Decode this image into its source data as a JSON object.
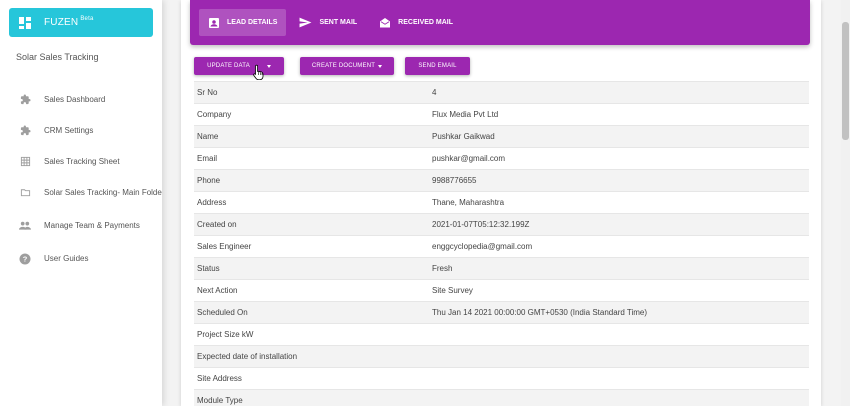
{
  "sidebar": {
    "brand": "FUZEN",
    "brand_badge": "Beta",
    "app_name": "Solar Sales Tracking",
    "items": [
      {
        "label": "Sales Dashboard",
        "icon": "puzzle-icon"
      },
      {
        "label": "CRM Settings",
        "icon": "puzzle-icon"
      },
      {
        "label": "Sales Tracking Sheet",
        "icon": "table-icon"
      },
      {
        "label": "Solar Sales Tracking- Main Folder",
        "icon": "folder-icon"
      },
      {
        "label": "Manage Team & Payments",
        "icon": "people-icon"
      },
      {
        "label": "User Guides",
        "icon": "help-icon"
      }
    ]
  },
  "tabs": [
    {
      "label": "LEAD DETAILS",
      "icon": "contact-card-icon",
      "active": true
    },
    {
      "label": "SENT MAIL",
      "icon": "send-icon",
      "active": false
    },
    {
      "label": "RECEIVED MAIL",
      "icon": "drafts-icon",
      "active": false
    }
  ],
  "actions": {
    "update_data": "UPDATE DATA",
    "create_document": "CREATE DOCUMENT",
    "send_email": "SEND EMAIL"
  },
  "details": [
    {
      "key": "Sr No",
      "value": "4"
    },
    {
      "key": "Company",
      "value": "Flux Media Pvt Ltd"
    },
    {
      "key": "Name",
      "value": "Pushkar Gaikwad"
    },
    {
      "key": "Email",
      "value": "pushkar@gmail.com"
    },
    {
      "key": "Phone",
      "value": "9988776655"
    },
    {
      "key": "Address",
      "value": "Thane, Maharashtra"
    },
    {
      "key": "Created on",
      "value": "2021-01-07T05:12:32.199Z"
    },
    {
      "key": "Sales Engineer",
      "value": "enggcyclopedia@gmail.com"
    },
    {
      "key": "Status",
      "value": "Fresh"
    },
    {
      "key": "Next Action",
      "value": "Site Survey"
    },
    {
      "key": "Scheduled On",
      "value": "Thu Jan 14 2021 00:00:00 GMT+0530 (India Standard Time)"
    },
    {
      "key": "Project Size kW",
      "value": ""
    },
    {
      "key": "Expected date of installation",
      "value": ""
    },
    {
      "key": "Site Address",
      "value": ""
    },
    {
      "key": "Module Type",
      "value": ""
    }
  ],
  "colors": {
    "brand": "#26c6da",
    "accent": "#9c27b0"
  }
}
